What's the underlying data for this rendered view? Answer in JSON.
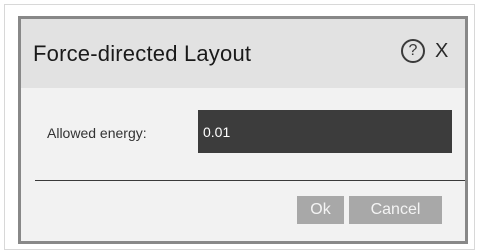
{
  "dialog": {
    "title": "Force-directed Layout",
    "help_label": "?",
    "close_label": "X",
    "field": {
      "label": "Allowed energy:",
      "value": "0.01"
    },
    "buttons": {
      "ok_label": "Ok",
      "cancel_label": "Cancel"
    }
  }
}
